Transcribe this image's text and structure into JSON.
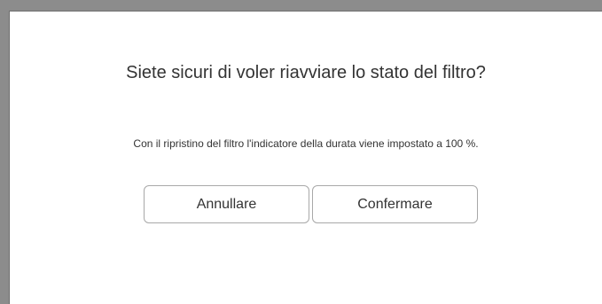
{
  "dialog": {
    "title": "Siete sicuri di voler riavviare lo stato del filtro?",
    "message": "Con il ripristino del filtro l'indicatore della durata viene impostato a 100 %.",
    "cancel_label": "Annullare",
    "confirm_label": "Confermare"
  },
  "colors": {
    "backdrop": "#8c8c8c",
    "dialog_background": "#ffffff",
    "text": "#333333",
    "button_border": "#a8a8a8"
  }
}
